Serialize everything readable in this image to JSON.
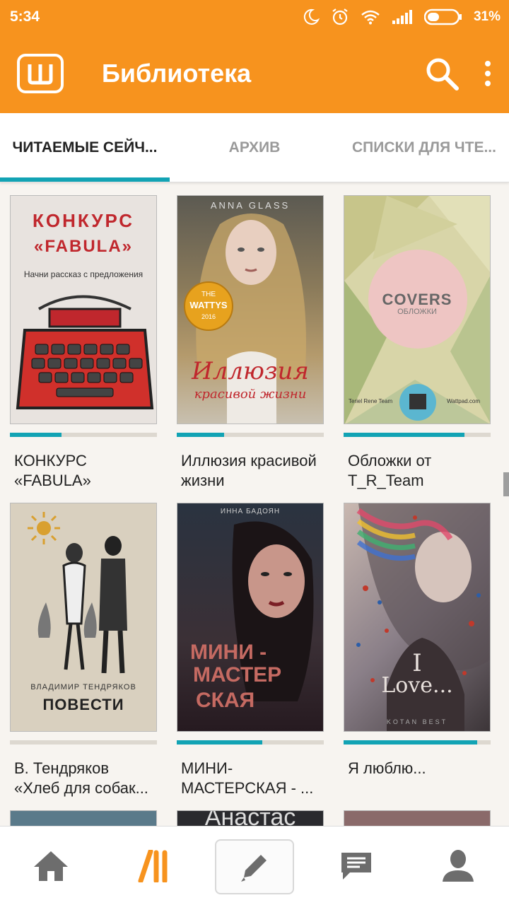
{
  "status_bar": {
    "time": "5:34",
    "battery": "31%"
  },
  "app_bar": {
    "title": "Библиотека"
  },
  "tabs": [
    {
      "label": "ЧИТАЕМЫЕ СЕЙЧ..."
    },
    {
      "label": "АРХИВ"
    },
    {
      "label": "СПИСКИ ДЛЯ ЧТЕ..."
    }
  ],
  "books": [
    {
      "title": "КОНКУРС «FABULA»",
      "progress": 0.35,
      "cover": {
        "line1": "КОНКУРС",
        "line2": "«FABULA»",
        "line3": "Начни рассказ с предложения"
      }
    },
    {
      "title": "Иллюзия красивой жизни",
      "progress": 0.32,
      "cover": {
        "author": "ANNA GLASS",
        "badge_top": "THE",
        "badge_mid": "WATTYS",
        "badge_year": "2016",
        "line1": "Иллюзия",
        "line2": "красивой жизни"
      }
    },
    {
      "title": "Обложки от T_R_Team",
      "progress": 0.82,
      "cover": {
        "line1": "COVERS",
        "line2": "ОБЛОЖКИ",
        "left": "Teriel Rene Team",
        "right": "Wattpad.com"
      }
    },
    {
      "title": "В. Тендряков «Хлеб для собак...",
      "progress": 0,
      "cover": {
        "author": "ВЛАДИМИР ТЕНДРЯКОВ",
        "line1": "ПОВЕСТИ"
      }
    },
    {
      "title": "МИНИ-МАСТЕРСКАЯ - ...",
      "progress": 0.58,
      "cover": {
        "author": "ИННА БАДОЯН",
        "line1": "МИНИ -",
        "line2": "МАСТЕР",
        "line3": "СКАЯ"
      }
    },
    {
      "title": "Я люблю...",
      "progress": 0.91,
      "cover": {
        "line1": "I",
        "line2": "Love...",
        "footer": "KOTAN BEST"
      }
    }
  ],
  "peek_covers": [
    {
      "text": ""
    },
    {
      "text": "Анастас"
    },
    {
      "text": ""
    }
  ],
  "bottom_nav": [
    "home-icon",
    "library-icon",
    "write-icon",
    "messages-icon",
    "profile-icon"
  ],
  "colors": {
    "brand": "#f7931e",
    "accent": "#12a3b4"
  }
}
